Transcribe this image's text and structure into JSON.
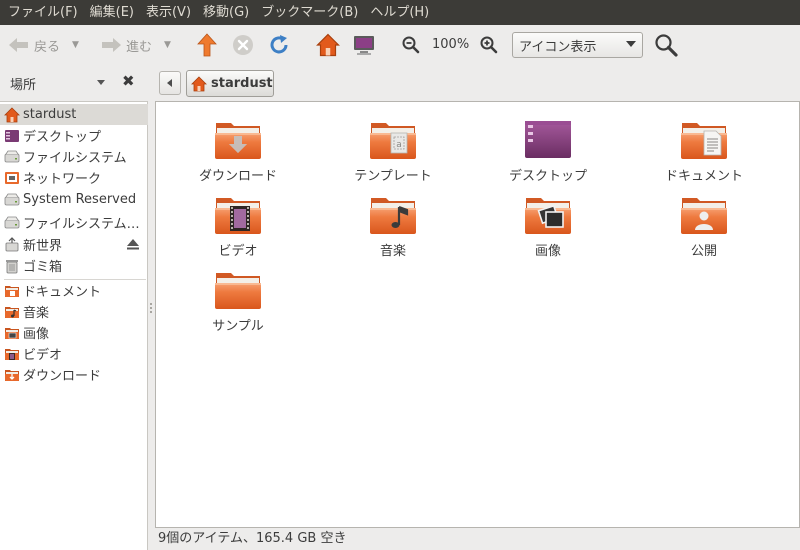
{
  "menubar": {
    "items": [
      "ファイル(F)",
      "編集(E)",
      "表示(V)",
      "移動(G)",
      "ブックマーク(B)",
      "ヘルプ(H)"
    ]
  },
  "toolbar": {
    "back_label": "戻る",
    "forward_label": "進む",
    "zoom_level": "100%",
    "view_mode": "アイコン表示"
  },
  "sidebar": {
    "title": "場所",
    "items": [
      {
        "label": "stardust",
        "icon": "home-icon",
        "selected": true
      },
      {
        "label": "デスクトップ",
        "icon": "desktop-icon"
      },
      {
        "label": "ファイルシステム",
        "icon": "drive-icon"
      },
      {
        "label": "ネットワーク",
        "icon": "network-icon"
      },
      {
        "label": "System Reserved",
        "icon": "drive-icon"
      },
      {
        "label": "ファイルシステム…",
        "icon": "drive-icon"
      },
      {
        "label": "新世界",
        "icon": "removable-drive-icon"
      },
      {
        "label": "ゴミ箱",
        "icon": "trash-icon"
      }
    ],
    "bookmarks": [
      {
        "label": "ドキュメント",
        "icon": "documents-folder-icon"
      },
      {
        "label": "音楽",
        "icon": "music-folder-icon"
      },
      {
        "label": "画像",
        "icon": "pictures-folder-icon"
      },
      {
        "label": "ビデオ",
        "icon": "videos-folder-icon"
      },
      {
        "label": "ダウンロード",
        "icon": "downloads-folder-icon"
      }
    ]
  },
  "location": {
    "crumb": "stardust"
  },
  "files": [
    {
      "name": "ダウンロード",
      "icon": "downloads-folder-icon"
    },
    {
      "name": "テンプレート",
      "icon": "templates-folder-icon"
    },
    {
      "name": "デスクトップ",
      "icon": "desktop-folder-icon"
    },
    {
      "name": "ドキュメント",
      "icon": "documents-folder-icon"
    },
    {
      "name": "ビデオ",
      "icon": "videos-folder-icon"
    },
    {
      "name": "音楽",
      "icon": "music-folder-icon"
    },
    {
      "name": "画像",
      "icon": "pictures-folder-icon"
    },
    {
      "name": "公開",
      "icon": "public-folder-icon"
    },
    {
      "name": "サンプル",
      "icon": "folder-icon"
    }
  ],
  "status": {
    "text": "9個のアイテム、165.4 GB 空き"
  },
  "colors": {
    "menubar_bg": "#3c3b37",
    "folder_orange": "#e8692c",
    "desktop_purple": "#7a3a74",
    "home_orange": "#e25a1c"
  }
}
